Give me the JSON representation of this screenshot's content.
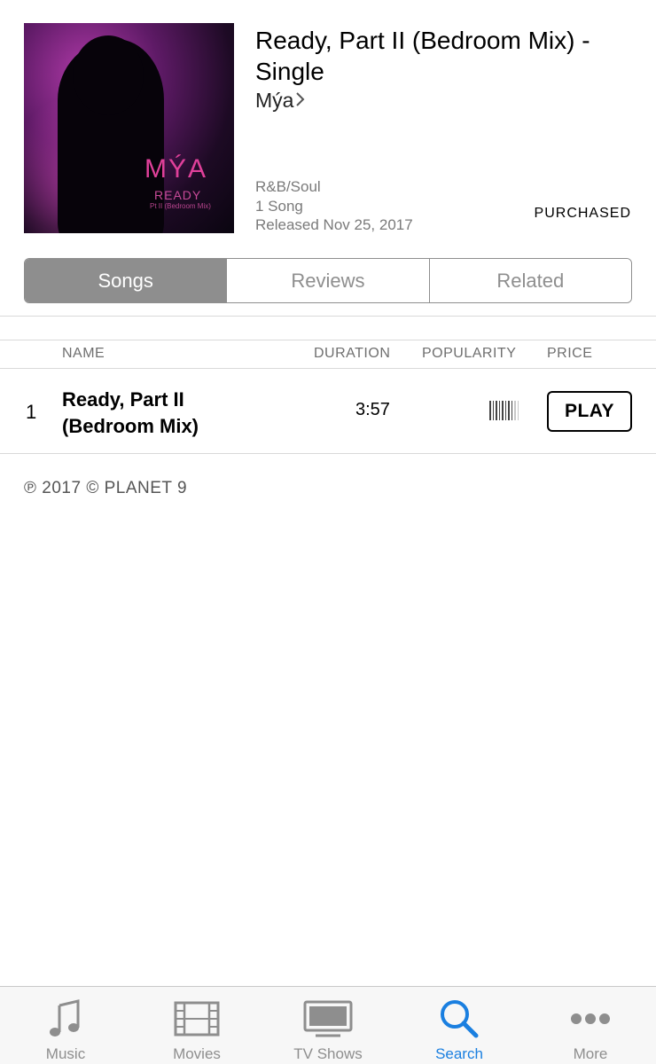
{
  "album": {
    "title": "Ready, Part II (Bedroom Mix) - Single",
    "artist": "Mýa",
    "genre": "R&B/Soul",
    "song_count": "1 Song",
    "released": "Released Nov 25, 2017",
    "status": "PURCHASED",
    "artwork": {
      "artist_text": "MÝA",
      "title_text": "READY",
      "subtitle_text": "Pt II (Bedroom Mix)"
    }
  },
  "segments": {
    "songs": "Songs",
    "reviews": "Reviews",
    "related": "Related",
    "selected": "Songs"
  },
  "table": {
    "headers": {
      "name": "NAME",
      "duration": "DURATION",
      "popularity": "POPULARITY",
      "price": "PRICE"
    },
    "rows": [
      {
        "number": "1",
        "name": "Ready, Part II (Bedroom Mix)",
        "duration": "3:57",
        "popularity": 0.75,
        "button": "PLAY"
      }
    ]
  },
  "copyright": "℗ 2017 © PLANET 9",
  "tabbar": {
    "selected": "Search",
    "accent_color": "#1a7fe0",
    "items": [
      {
        "label": "Music",
        "icon": "music-note-icon"
      },
      {
        "label": "Movies",
        "icon": "film-icon"
      },
      {
        "label": "TV Shows",
        "icon": "tv-icon"
      },
      {
        "label": "Search",
        "icon": "search-icon"
      },
      {
        "label": "More",
        "icon": "more-dots-icon"
      }
    ]
  }
}
